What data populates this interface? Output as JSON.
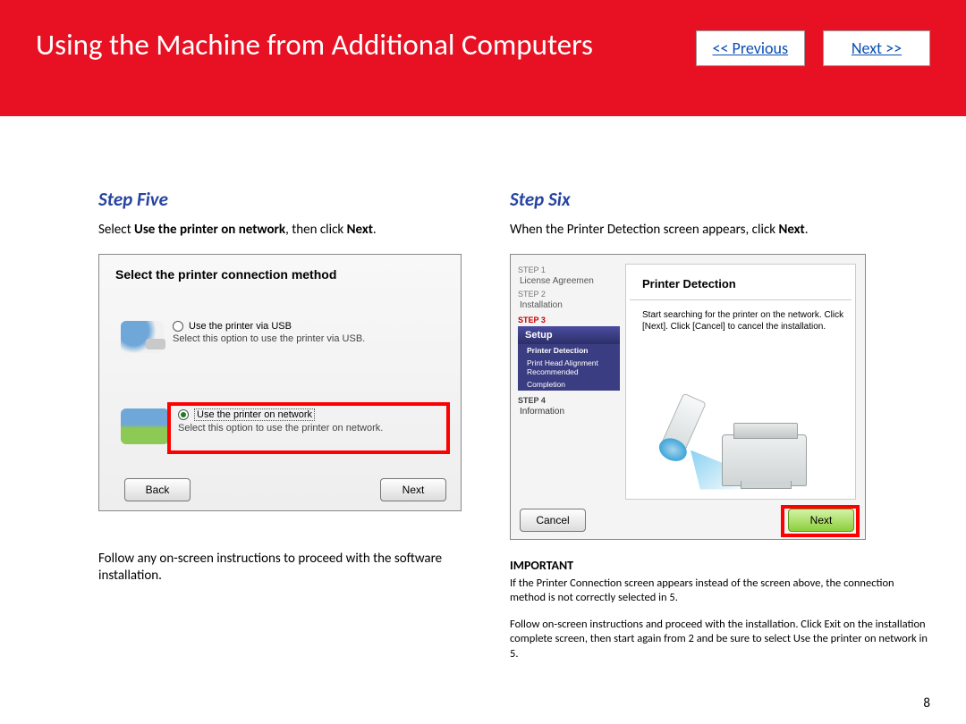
{
  "banner": {
    "title": "Using the Machine from Additional Computers",
    "previous": "<< Previous",
    "next": "Next >>"
  },
  "page_number": "8",
  "step5": {
    "title": "Step Five",
    "instr_pre": "Select ",
    "instr_bold1": "Use the printer on network",
    "instr_mid": ", then click ",
    "instr_bold2": "Next",
    "instr_end": ".",
    "shot_title": "Select the printer connection method",
    "opt1_label": "Use the printer via USB",
    "opt1_desc": "Select this option to use the printer via USB.",
    "opt2_label": "Use the printer on network",
    "opt2_desc": "Select this option to use the printer on network.",
    "back_btn": "Back",
    "next_btn": "Next",
    "followup": "Follow any on-screen instructions to proceed with the software installation."
  },
  "step6": {
    "title": "Step Six",
    "instr_pre": "When the Printer Detection screen appears, click ",
    "instr_bold": "Next",
    "instr_end": ".",
    "sidebar": {
      "s1_label": "STEP 1",
      "s1_text": "License Agreemen",
      "s2_label": "STEP 2",
      "s2_text": "Installation",
      "s3_label": "STEP 3",
      "setup": "Setup",
      "sub1": "Printer Detection",
      "sub2": "Print Head Alignment Recommended",
      "sub3": "Completion",
      "s4_label": "STEP 4",
      "s4_text": "Information"
    },
    "main_title": "Printer Detection",
    "main_text": "Start searching for the printer on the network. Click [Next]. Click [Cancel] to cancel the installation.",
    "cancel_btn": "Cancel",
    "next_btn": "Next",
    "important_title": "IMPORTANT",
    "important_p1": "If the Printer Connection screen appears instead of the screen above, the connection method is not correctly selected in 5.",
    "important_p2": "Follow on-screen instructions and proceed with the installation. Click Exit on the installation complete screen, then start again from 2 and be sure to select Use the printer on network in 5."
  }
}
